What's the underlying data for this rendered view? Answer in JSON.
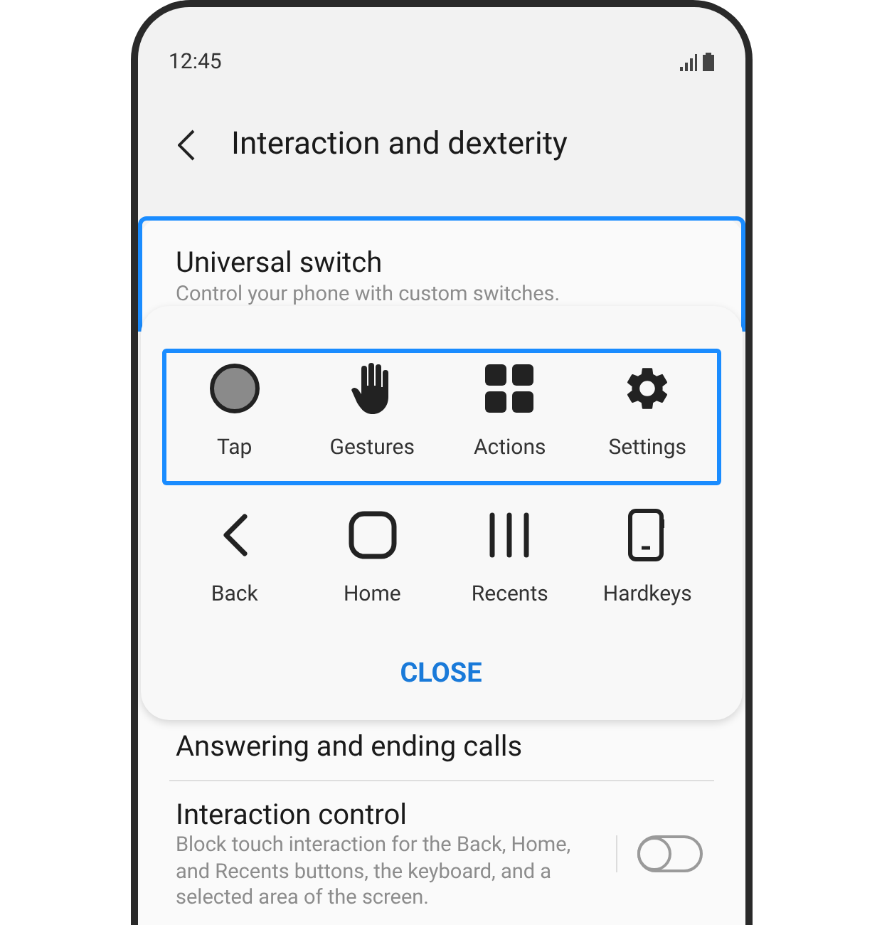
{
  "status_bar": {
    "time": "12:45"
  },
  "header": {
    "title": "Interaction and dexterity"
  },
  "settings": [
    {
      "kind": "item",
      "title": "Universal switch",
      "description": "Control your phone with custom switches.",
      "highlighted": true
    },
    {
      "kind": "item",
      "title": "Answering and ending calls",
      "highlighted": false
    },
    {
      "kind": "toggle",
      "title": "Interaction control",
      "description": "Block touch interaction for the Back, Home, and Recents buttons, the keyboard, and a selected area of the screen.",
      "on": false
    }
  ],
  "menu": {
    "groups": [
      {
        "highlighted": true,
        "items": [
          {
            "kind": "tap",
            "label": "Tap"
          },
          {
            "kind": "gestures",
            "label": "Gestures"
          },
          {
            "kind": "actions",
            "label": "Actions"
          },
          {
            "kind": "settings",
            "label": "Settings"
          }
        ]
      },
      {
        "highlighted": false,
        "items": [
          {
            "kind": "back",
            "label": "Back"
          },
          {
            "kind": "home",
            "label": "Home"
          },
          {
            "kind": "recents",
            "label": "Recents"
          },
          {
            "kind": "hardkeys",
            "label": "Hardkeys"
          }
        ]
      }
    ],
    "close_label": "CLOSE"
  }
}
